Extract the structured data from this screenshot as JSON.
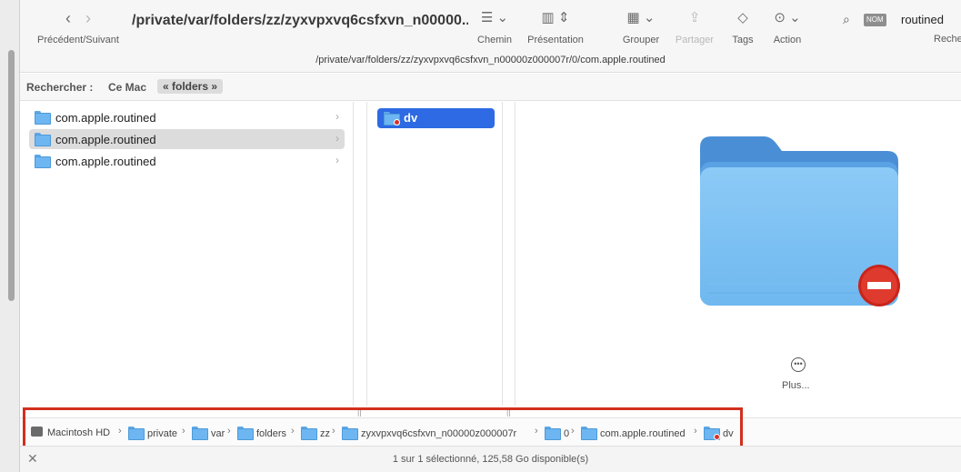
{
  "toolbar": {
    "nav_label": "Précédent/Suivant",
    "title": "/private/var/folders/zz/zyxvpxvq6csfxvn_n00000...",
    "subtitle": "/private/var/folders/zz/zyxvpxvq6csfxvn_n00000z000007r/0/com.apple.routined",
    "items": [
      {
        "label": "Chemin",
        "icon": "path-icon"
      },
      {
        "label": "Présentation",
        "icon": "columns-view-icon"
      },
      {
        "label": "Grouper",
        "icon": "group-icon"
      },
      {
        "label": "Partager",
        "icon": "share-icon",
        "disabled": true
      },
      {
        "label": "Tags",
        "icon": "tag-icon"
      },
      {
        "label": "Action",
        "icon": "action-icon"
      }
    ],
    "search": {
      "scope_badge": "NOM",
      "value": "routined",
      "label": "Reche"
    }
  },
  "scope_bar": {
    "label": "Rechercher :",
    "this_mac": "Ce Mac",
    "folder": "« folders »"
  },
  "column1": {
    "items": [
      {
        "name": "com.apple.routined",
        "selected": false
      },
      {
        "name": "com.apple.routined",
        "selected": true
      },
      {
        "name": "com.apple.routined",
        "selected": false
      }
    ]
  },
  "column2": {
    "items": [
      {
        "name": "dv",
        "selected": true
      }
    ]
  },
  "preview": {
    "more_label": "Plus..."
  },
  "path_bar": {
    "segments": [
      "Macintosh HD",
      "private",
      "var",
      "folders",
      "zz",
      "zyxvpxvq6csfxvn_n00000z000007r",
      "0",
      "com.apple.routined",
      "dv"
    ]
  },
  "status": {
    "text": "1 sur 1 sélectionné, 125,58 Go disponible(s)"
  },
  "colors": {
    "selection": "#2d6ae3",
    "highlight_box": "#d32f1f",
    "folder_blue": "#6db6f2"
  }
}
